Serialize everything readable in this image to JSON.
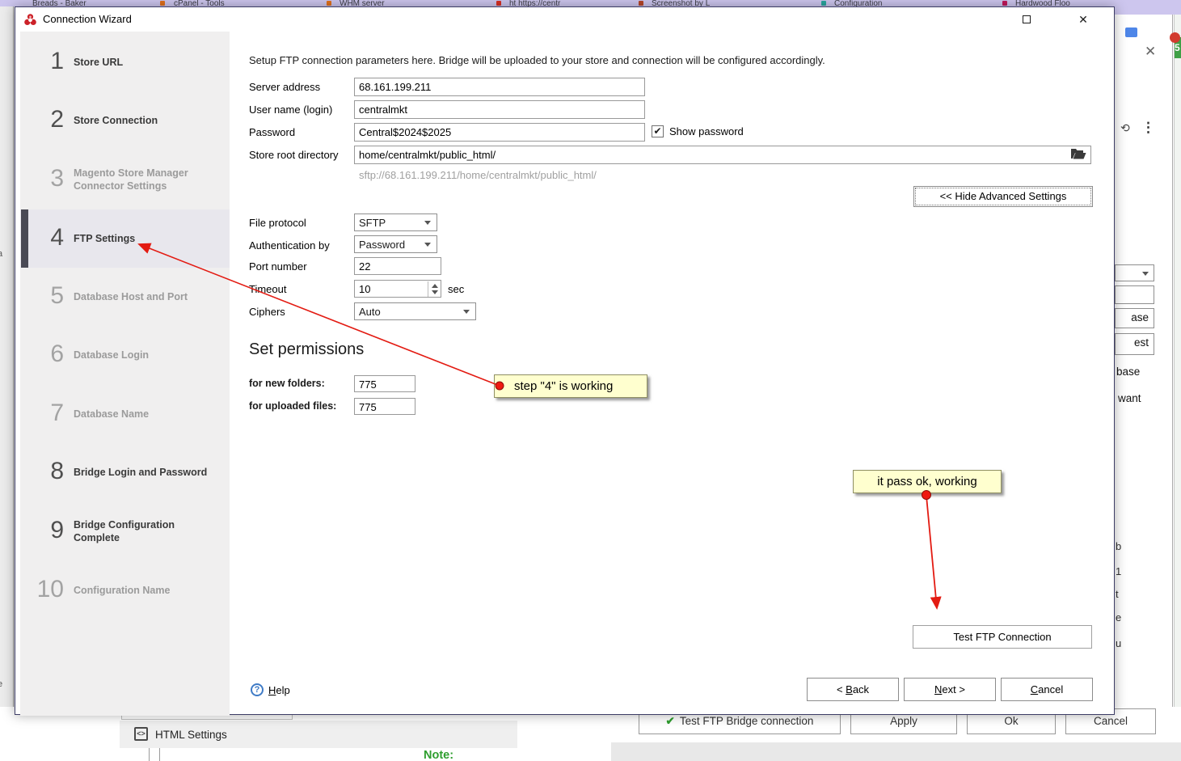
{
  "tabs_strip": {
    "fragments": [
      "Breads - Baker",
      "cPanel - Tools",
      "WHM server",
      "ht https://centr",
      "Screenshot by L",
      "Configuration",
      "Hardwood Floo"
    ]
  },
  "window": {
    "title": "Connection Wizard"
  },
  "icons": {
    "close": "✕",
    "kebab": "⋮",
    "check": "✔",
    "help_q": "?",
    "code": "<>",
    "refresh": "⟲"
  },
  "sidebar": {
    "steps": [
      {
        "num": "1",
        "label": "Store URL"
      },
      {
        "num": "2",
        "label": "Store Connection"
      },
      {
        "num": "3",
        "label": "Magento Store Manager Connector Settings"
      },
      {
        "num": "4",
        "label": "FTP Settings"
      },
      {
        "num": "5",
        "label": "Database Host and Port"
      },
      {
        "num": "6",
        "label": "Database Login"
      },
      {
        "num": "7",
        "label": "Database Name"
      },
      {
        "num": "8",
        "label": "Bridge Login and Password"
      },
      {
        "num": "9",
        "label": "Bridge Configuration Complete"
      },
      {
        "num": "10",
        "label": "Configuration Name"
      }
    ]
  },
  "form": {
    "intro": "Setup FTP connection parameters here. Bridge will be uploaded to your store and connection will be configured accordingly.",
    "server_address": {
      "label": "Server address",
      "value": "68.161.199.211"
    },
    "username": {
      "label": "User name (login)",
      "value": "centralmkt"
    },
    "password": {
      "label": "Password",
      "value": "Central$2024$2025"
    },
    "show_password": {
      "label": "Show password"
    },
    "store_root": {
      "label": "Store root directory",
      "value": "home/centralmkt/public_html/"
    },
    "sftp_hint": "sftp://68.161.199.211/home/centralmkt/public_html/",
    "advanced_button": "<< Hide Advanced Settings",
    "file_protocol": {
      "label": "File protocol",
      "value": "SFTP"
    },
    "auth_by": {
      "label": "Authentication by",
      "value": "Password"
    },
    "port": {
      "label": "Port number",
      "value": "22"
    },
    "timeout": {
      "label": "Timeout",
      "value": "10",
      "unit": "sec"
    },
    "ciphers": {
      "label": "Ciphers",
      "value": "Auto"
    },
    "permissions": {
      "heading": "Set permissions",
      "new_folders": {
        "label": "for new folders:",
        "value": "775"
      },
      "uploaded_files": {
        "label": "for uploaded files:",
        "value": "775"
      }
    },
    "test_ftp_button": "Test FTP Connection",
    "help": {
      "accel": "H",
      "rest": "elp"
    },
    "back": {
      "pre": "< ",
      "accel": "B",
      "rest": "ack"
    },
    "next": {
      "accel": "N",
      "rest": "ext >"
    },
    "cancel": {
      "accel": "C",
      "rest": "ancel"
    }
  },
  "annotations": {
    "note_step4": "step \"4\" is working",
    "note_pass": "it pass ok, working"
  },
  "background": {
    "html_settings": "HTML Settings",
    "note": "Note:",
    "btn_test_bridge": "Test FTP Bridge connection",
    "btn_apply": "Apply",
    "btn_ok": "Ok",
    "btn_cancel": "Cancel",
    "right_fragments": {
      "f1": "ase",
      "f2": "est",
      "f3": "base",
      "f4": "want",
      "l1": "b",
      "l2": "1",
      "l3": "t",
      "l4": "e",
      "l5": "u",
      "badge": "5"
    },
    "left_fragments": {
      "a": "a",
      "e": "e"
    }
  }
}
